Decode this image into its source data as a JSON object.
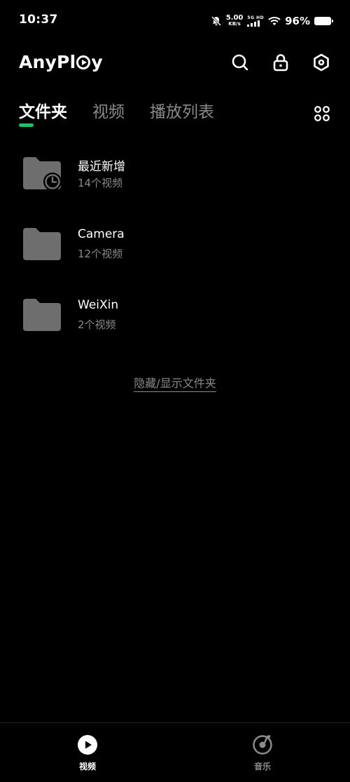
{
  "status_bar": {
    "time": "10:37",
    "net_speed_value": "5.00",
    "net_speed_unit": "KB/s",
    "signal_label": "5G HD",
    "battery": "96%"
  },
  "header": {
    "logo_part1": "AnyPl",
    "logo_part2": "y",
    "icons": [
      "search-icon",
      "lock-icon",
      "settings-icon"
    ]
  },
  "tabs": [
    {
      "label": "文件夹",
      "active": true
    },
    {
      "label": "视频",
      "active": false
    },
    {
      "label": "播放列表",
      "active": false
    }
  ],
  "folders": [
    {
      "name": "最近新增",
      "count": "14个视频",
      "icon": "folder-clock-icon"
    },
    {
      "name": "Camera",
      "count": "12个视频",
      "icon": "folder-icon"
    },
    {
      "name": "WeiXin",
      "count": "2个视频",
      "icon": "folder-icon"
    }
  ],
  "hide_show_link": "隐藏/显示文件夹",
  "bottom_nav": {
    "video_label": "视频",
    "music_label": "音乐"
  },
  "colors": {
    "background": "#000000",
    "accent": "#1dc26a",
    "muted_text": "#8a8a8a",
    "folder": "#6e6e6e"
  }
}
